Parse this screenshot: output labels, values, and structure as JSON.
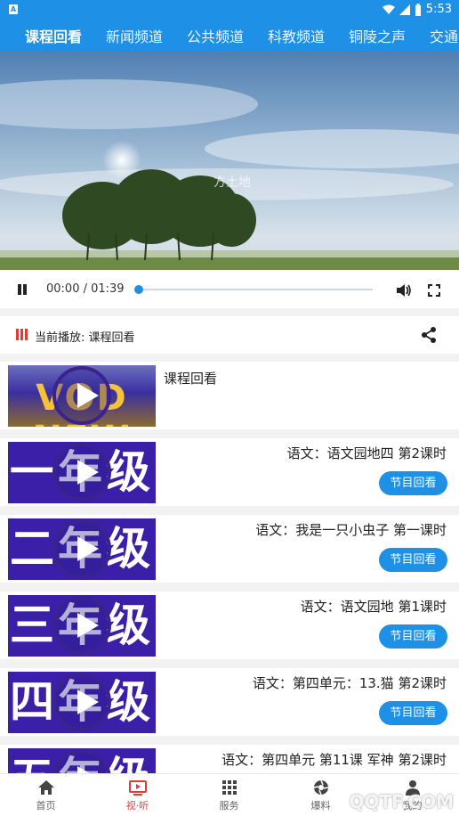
{
  "status_bar": {
    "app_icon_letter": "A",
    "time": "5:53"
  },
  "tabs": [
    {
      "label": "课程回看",
      "active": true
    },
    {
      "label": "新闻频道",
      "active": false
    },
    {
      "label": "公共频道",
      "active": false
    },
    {
      "label": "科教频道",
      "active": false
    },
    {
      "label": "铜陵之声",
      "active": false
    },
    {
      "label": "交通",
      "active": false
    }
  ],
  "player": {
    "video_caption": "方土地",
    "time_display": "00:00 / 01:39",
    "progress": 0
  },
  "now_playing": {
    "label": "当前播放: 课程回看"
  },
  "items": [
    {
      "title": "课程回看",
      "thumb_text": "VOD NEW",
      "button": ""
    },
    {
      "title": "语文：语文园地四 第2课时",
      "thumb_text": "一年级",
      "button": "节目回看"
    },
    {
      "title": "语文：我是一只小虫子 第一课时",
      "thumb_text": "二年级",
      "button": "节目回看"
    },
    {
      "title": "语文：语文园地 第1课时",
      "thumb_text": "三年级",
      "button": "节目回看"
    },
    {
      "title": "语文：第四单元：13.猫 第2课时",
      "thumb_text": "四年级",
      "button": "节目回看"
    },
    {
      "title": "语文：第四单元 第11课 军神 第2课时",
      "thumb_text": "五年级",
      "button": ""
    }
  ],
  "bottom_nav": [
    {
      "label": "首页",
      "icon": "home-icon",
      "active": false
    },
    {
      "label": "视·听",
      "icon": "tv-icon",
      "active": true
    },
    {
      "label": "服务",
      "icon": "grid-icon",
      "active": false
    },
    {
      "label": "爆料",
      "icon": "camera-aperture-icon",
      "active": false
    },
    {
      "label": "我的",
      "icon": "user-icon",
      "active": false
    }
  ],
  "watermark": "QQTF.COM",
  "colors": {
    "accent": "#1e90e6",
    "active_red": "#e53935",
    "grade_purple": "#3b1fa8"
  }
}
